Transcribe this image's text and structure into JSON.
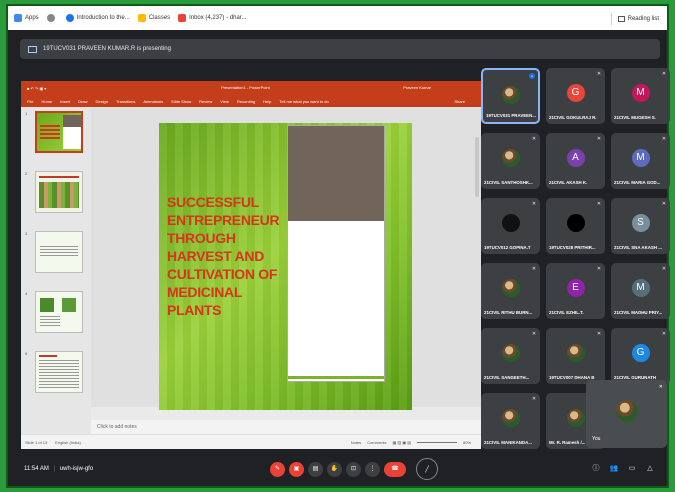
{
  "bookmarks": {
    "items": [
      {
        "label": "Apps",
        "color": "#4285f4"
      },
      {
        "label": "",
        "color": "#888888"
      },
      {
        "label": "Introduction to the...",
        "color": "#1a73e8"
      },
      {
        "label": "Classes",
        "color": "#fbbc04"
      },
      {
        "label": "Inbox (4,237) - dhar...",
        "color": "#ea4335"
      }
    ],
    "reading_list": "Reading list"
  },
  "presenting": {
    "text": "19TUCV031 PRAVEEN KUMAR.R is presenting"
  },
  "powerpoint": {
    "title": "Presentation1 - PowerPoint",
    "user": "Praveen Kumar",
    "menu": [
      "File",
      "Home",
      "Insert",
      "Draw",
      "Design",
      "Transitions",
      "Animations",
      "Slide Show",
      "Review",
      "View",
      "Recording",
      "Help",
      "Tell me what you want to do"
    ],
    "share": "Share",
    "slide_numbers": [
      "1",
      "2",
      "3",
      "4",
      "5"
    ],
    "slide_title": "SUCCESSFUL ENTREPRENEUR THROUGH HARVEST AND CULTIVATION OF MEDICINAL PLANTS",
    "notes_placeholder": "Click to add notes",
    "status_slide": "Slide 1 of 13",
    "status_lang": "English (India)",
    "status_notes": "Notes",
    "status_comments": "Comments",
    "status_zoom": "80%"
  },
  "participants": [
    {
      "name": "19TUCV031 PRAVEEN...",
      "initial": "",
      "color": "#5f6368",
      "photo": true,
      "active": true
    },
    {
      "name": "21CIVIL GOKULRAJ R.",
      "initial": "G",
      "color": "#e8453c",
      "photo": false
    },
    {
      "name": "21CIVIL MUGESH S.",
      "initial": "M",
      "color": "#c2185b",
      "photo": false
    },
    {
      "name": "21CIVIL SANTHOSHK...",
      "initial": "",
      "color": "#5f6368",
      "photo": true
    },
    {
      "name": "21CIVIL AKASH K.",
      "initial": "A",
      "color": "#7b3fb0",
      "photo": false
    },
    {
      "name": "21CIVIL MARIA GOD...",
      "initial": "M",
      "color": "#5c6bc0",
      "photo": false
    },
    {
      "name": "19TUCV012 GOPINA.T",
      "initial": "",
      "color": "#111111",
      "photo": false
    },
    {
      "name": "19TUCV028 PRITHIR...",
      "initial": "",
      "color": "#000000",
      "photo": false
    },
    {
      "name": "21CIVIL SNA AKASH ...",
      "initial": "S",
      "color": "#78909c",
      "photo": false
    },
    {
      "name": "21CIVIL RITHU BURN...",
      "initial": "",
      "color": "#5f6368",
      "photo": true
    },
    {
      "name": "21CIVIL EZHIL.T.",
      "initial": "E",
      "color": "#8e24aa",
      "photo": false
    },
    {
      "name": "21CIVIL MADHU PRIY...",
      "initial": "M",
      "color": "#546e7a",
      "photo": false
    },
    {
      "name": "21CIVIL SANGEETH...",
      "initial": "",
      "color": "#5f6368",
      "photo": true
    },
    {
      "name": "19TUCV007 DHANA B",
      "initial": "",
      "color": "#5f6368",
      "photo": true
    },
    {
      "name": "21CIVIL GURUNATH",
      "initial": "G",
      "color": "#1e88e5",
      "photo": false
    },
    {
      "name": "21CIVIL MANIKANDA...",
      "initial": "",
      "color": "#5f6368",
      "photo": true
    },
    {
      "name": "Mr. R. Ramesh /...",
      "initial": "",
      "color": "#5f6368",
      "photo": true
    }
  ],
  "self": {
    "label": "You"
  },
  "meeting": {
    "time": "11:54 AM",
    "code": "uwh-isjw-gfo"
  },
  "controls": {
    "mic": "mic-off-icon",
    "camera": "camera-off-icon",
    "captions": "captions-icon",
    "hand": "raise-hand-icon",
    "present": "present-icon",
    "more": "more-icon",
    "end": "end-call-icon"
  }
}
